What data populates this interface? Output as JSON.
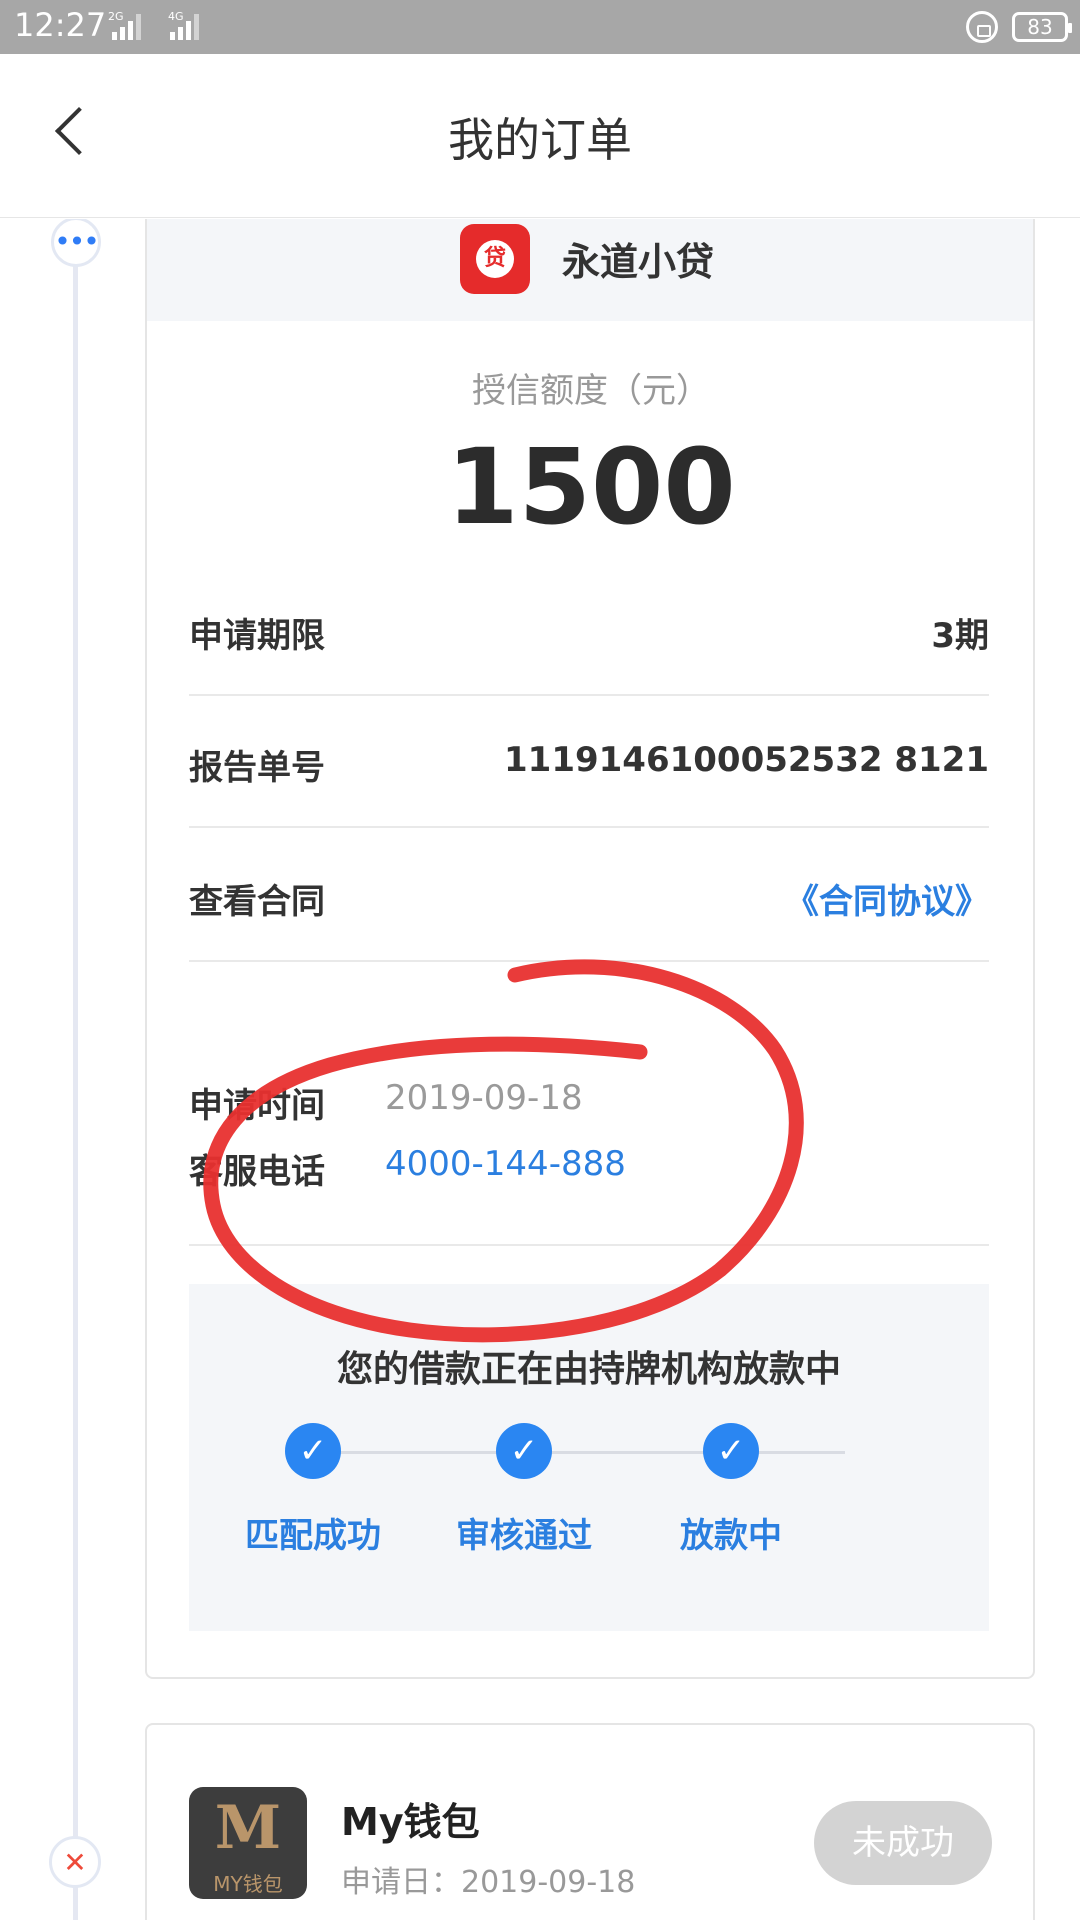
{
  "status_bar": {
    "time": "12:27",
    "signal1_label": "2G",
    "signal2_label": "4G",
    "battery": "83"
  },
  "nav": {
    "title": "我的订单"
  },
  "order": {
    "app_name": "永道小贷",
    "app_icon_glyph": "贷",
    "credit_label": "授信额度（元）",
    "credit_amount": "1500",
    "rows": [
      {
        "label": "申请期限",
        "value": "3期"
      },
      {
        "label": "报告单号",
        "value": "1119146100052532 8121"
      },
      {
        "label": "查看合同",
        "value": "《合同协议》"
      }
    ],
    "apply_time_label": "申请时间",
    "apply_time": "2019-09-18",
    "service_phone_label": "客服电话",
    "service_phone": "4000-144-888",
    "status_title": "您的借款正在由持牌机构放款中",
    "steps": [
      {
        "label": "匹配成功"
      },
      {
        "label": "审核通过"
      },
      {
        "label": "放款中"
      }
    ],
    "check_glyph": "✓"
  },
  "order2": {
    "logo_text": "MY钱包",
    "name": "My钱包",
    "date": "申请日：2019-09-18",
    "status": "未成功"
  },
  "timeline": {
    "dots_glyph": "•••",
    "fail_glyph": "✕"
  },
  "colors": {
    "accent_blue": "#2b7fe0",
    "annotation_red": "#e8302f",
    "status_bar": "#a7a7a7"
  }
}
